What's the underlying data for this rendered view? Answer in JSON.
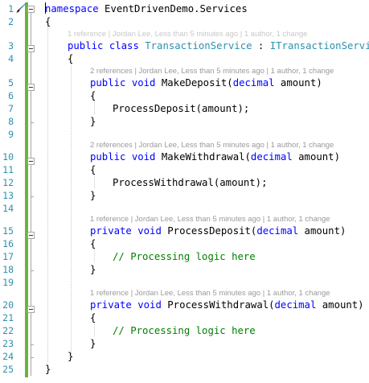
{
  "line_numbers": [
    "1",
    "2",
    "3",
    "4",
    "5",
    "6",
    "7",
    "8",
    "9",
    "10",
    "11",
    "12",
    "13",
    "14",
    "15",
    "16",
    "17",
    "18",
    "19",
    "20",
    "21",
    "22",
    "23",
    "24",
    "25"
  ],
  "code": {
    "l1_kw": "namespace",
    "l1_name": " EventDrivenDemo.Services",
    "open_brace": "{",
    "close_brace": "}",
    "l3_kw1": "public",
    "l3_kw2": " class",
    "l3_type": " TransactionService",
    "l3_colon": " : ",
    "l3_iface": "ITransactionService",
    "public": "public",
    "private": "private",
    "void": " void",
    "decimal": "decimal",
    "amount_close": " amount)",
    "m1_name": " MakeDeposit(",
    "m2_name": " MakeWithdrawal(",
    "m3_name": " ProcessDeposit(",
    "m4_name": " ProcessWithdrawal(",
    "call1": "ProcessDeposit(amount);",
    "call2": "ProcessWithdrawal(amount);",
    "comment": "// Processing logic here"
  },
  "codelens": {
    "class_lens": "1 reference | Jordan Lee, Less than 5 minutes ago | 1 author, 1 change",
    "m1_lens": "2 references | Jordan Lee, Less than 5 minutes ago | 1 author, 1 change",
    "m2_lens": "2 references | Jordan Lee, Less than 5 minutes ago | 1 author, 1 change",
    "m3_lens": "1 reference | Jordan Lee, Less than 5 minutes ago | 1 author, 1 change",
    "m4_lens": "1 reference | Jordan Lee, Less than 5 minutes ago | 1 author, 1 change"
  },
  "icons": {
    "quick_action": "paintbrush-icon",
    "fold": "collapse-icon"
  },
  "colors": {
    "keyword": "#0000ff",
    "type": "#2b91af",
    "comment": "#008000",
    "line_number": "#2b91af",
    "changed_bar": "#6cb33e"
  }
}
